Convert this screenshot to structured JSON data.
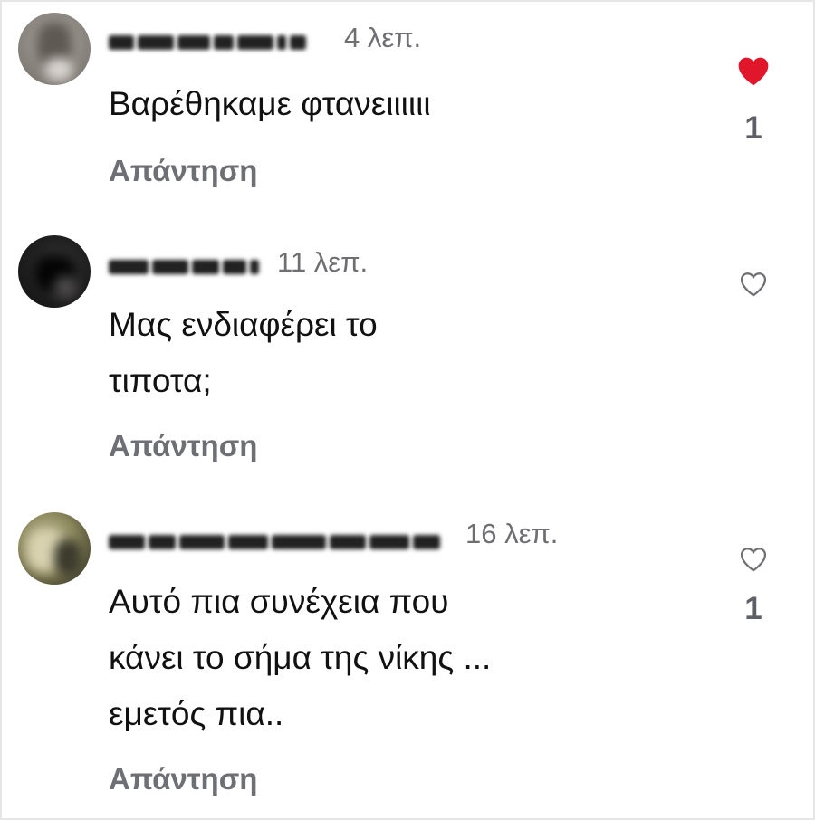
{
  "comments": [
    {
      "time": "4 λεπ.",
      "text": "Βαρέθηκαμε φτανειιιιιι",
      "reply_label": "Απάντηση",
      "liked": true,
      "likes": "1"
    },
    {
      "time": "11 λεπ.",
      "text": "Μας ενδιαφέρει  το\nτιποτα;",
      "reply_label": "Απάντηση",
      "liked": false,
      "likes": ""
    },
    {
      "time": "16 λεπ.",
      "text": "Αυτό πια συνέχεια που\nκάνει το σήμα της νίκης ...\nεμετός πια..",
      "reply_label": "Απάντηση",
      "liked": false,
      "likes": "1"
    }
  ],
  "colors": {
    "heart_liked": "#e0162b",
    "secondary_text": "#6e6e73",
    "reply_text": "#6e6f75"
  },
  "icons": {
    "liked": "heart-filled-icon",
    "unliked": "heart-outline-icon"
  }
}
